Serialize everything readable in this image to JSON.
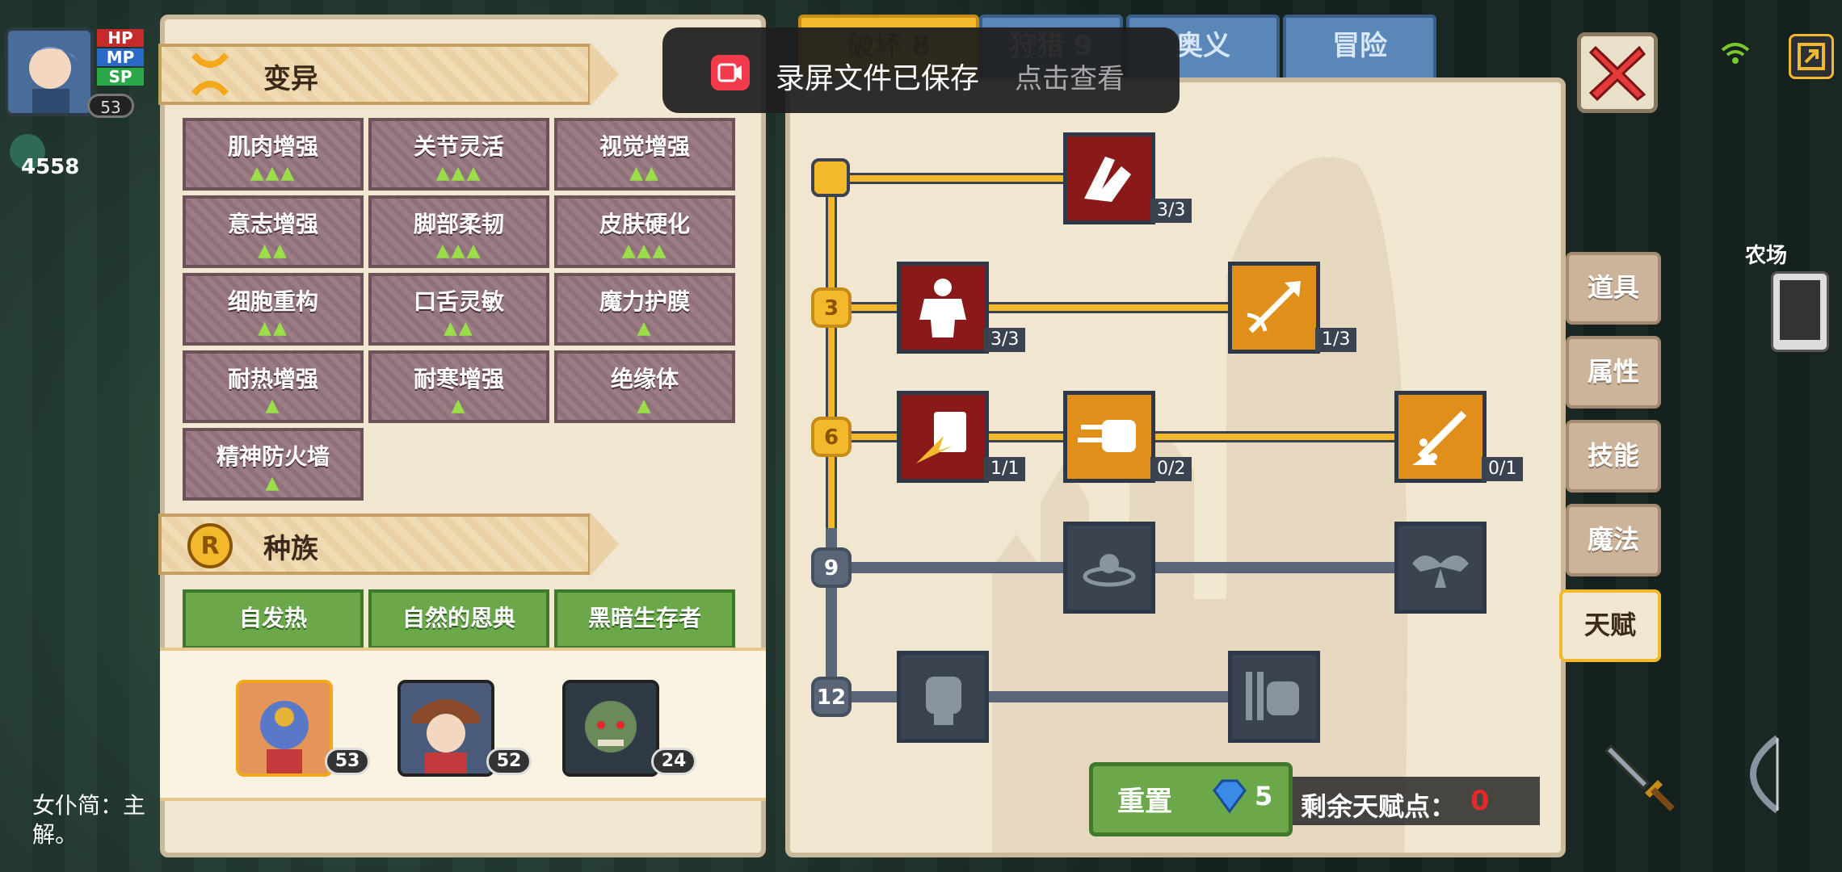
{
  "hud": {
    "bar_labels": [
      "HP",
      "MP",
      "SP"
    ],
    "level": "53",
    "currency": "4558",
    "dialogue": "女仆简：主",
    "dialogue_line2": "解。"
  },
  "mutation": {
    "title": "变异",
    "items": [
      {
        "name": "肌肉增强",
        "tier": "▲▲▲"
      },
      {
        "name": "关节灵活",
        "tier": "▲▲▲"
      },
      {
        "name": "视觉增强",
        "tier": "▲▲"
      },
      {
        "name": "意志增强",
        "tier": "▲▲"
      },
      {
        "name": "脚部柔韧",
        "tier": "▲▲▲"
      },
      {
        "name": "皮肤硬化",
        "tier": "▲▲▲"
      },
      {
        "name": "细胞重构",
        "tier": "▲▲"
      },
      {
        "name": "口舌灵敏",
        "tier": "▲▲"
      },
      {
        "name": "魔力护膜",
        "tier": "▲"
      },
      {
        "name": "耐热增强",
        "tier": "▲"
      },
      {
        "name": "耐寒增强",
        "tier": "▲"
      },
      {
        "name": "绝缘体",
        "tier": "▲"
      },
      {
        "name": "精神防火墙",
        "tier": "▲"
      }
    ]
  },
  "race": {
    "title": "种族",
    "items": [
      "自发热",
      "自然的恩典",
      "黑暗生存者"
    ]
  },
  "characters": [
    {
      "level": "53"
    },
    {
      "level": "52"
    },
    {
      "level": "24"
    }
  ],
  "top_tabs": [
    "破坏 8",
    "狩猎 9",
    "奥义",
    "冒险"
  ],
  "toast": {
    "message": "录屏文件已保存",
    "action": "点击查看"
  },
  "tree": {
    "tiers": [
      "3",
      "6",
      "9",
      "12"
    ],
    "counts": [
      "3/3",
      "3/3",
      "1/3",
      "1/1",
      "0/2",
      "0/1"
    ]
  },
  "side_tabs": [
    "道具",
    "属性",
    "技能",
    "魔法",
    "天赋"
  ],
  "farm_label": "农场",
  "reset": {
    "label": "重置",
    "cost": "5"
  },
  "remaining": {
    "label": "剩余天赋点：",
    "value": "0"
  },
  "colors": {
    "gold": "#f3b92c",
    "red_node": "#8a1a1a",
    "orange_node": "#e0901a",
    "mutation_tile": "#9c7d86",
    "race_tile": "#6aa84a"
  }
}
